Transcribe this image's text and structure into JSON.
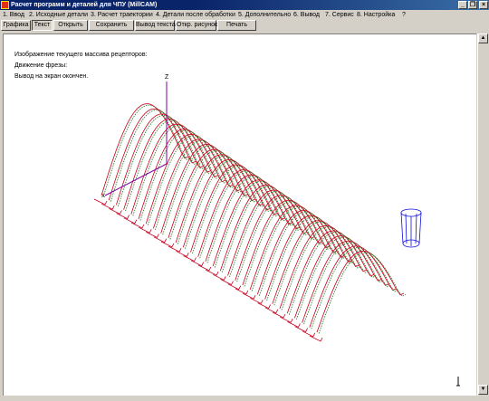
{
  "window": {
    "title": "Расчет программ и деталей для ЧПУ (MillCAM)",
    "minimize_label": "_",
    "maximize_label": "❐",
    "close_label": "×"
  },
  "menu": {
    "items": [
      {
        "label": "1. Ввод"
      },
      {
        "label": "2. Исходные детали"
      },
      {
        "label": "3. Расчет траектории"
      },
      {
        "label": "4. Детали после обработки"
      },
      {
        "label": "5. Дополнительно"
      },
      {
        "label": "6. Вывод"
      },
      {
        "label": "7. Сервис"
      },
      {
        "label": "8. Настройка"
      },
      {
        "label": "?"
      }
    ]
  },
  "toolbar": {
    "buttons": [
      {
        "label": "Графика"
      },
      {
        "label": "Текст"
      },
      {
        "label": "Открыть"
      },
      {
        "label": "Сохранить"
      },
      {
        "label": "Вывод текста"
      },
      {
        "label": "Откр. рисунок"
      },
      {
        "label": "Печать"
      }
    ]
  },
  "canvas": {
    "lines": [
      "Изображение текущего массива рецепторов:",
      "Движение фрезы:",
      "Вывод на экран окончен."
    ],
    "axis_z_label": "Z",
    "axis_x_label": "X",
    "colors": {
      "pass_red": "#c8001e",
      "pass_green": "#1e7a1e",
      "axis": "#8000a0",
      "tool": "#1010e0"
    }
  },
  "scrollbar": {
    "up_icon": "▲",
    "down_icon": "▼"
  }
}
